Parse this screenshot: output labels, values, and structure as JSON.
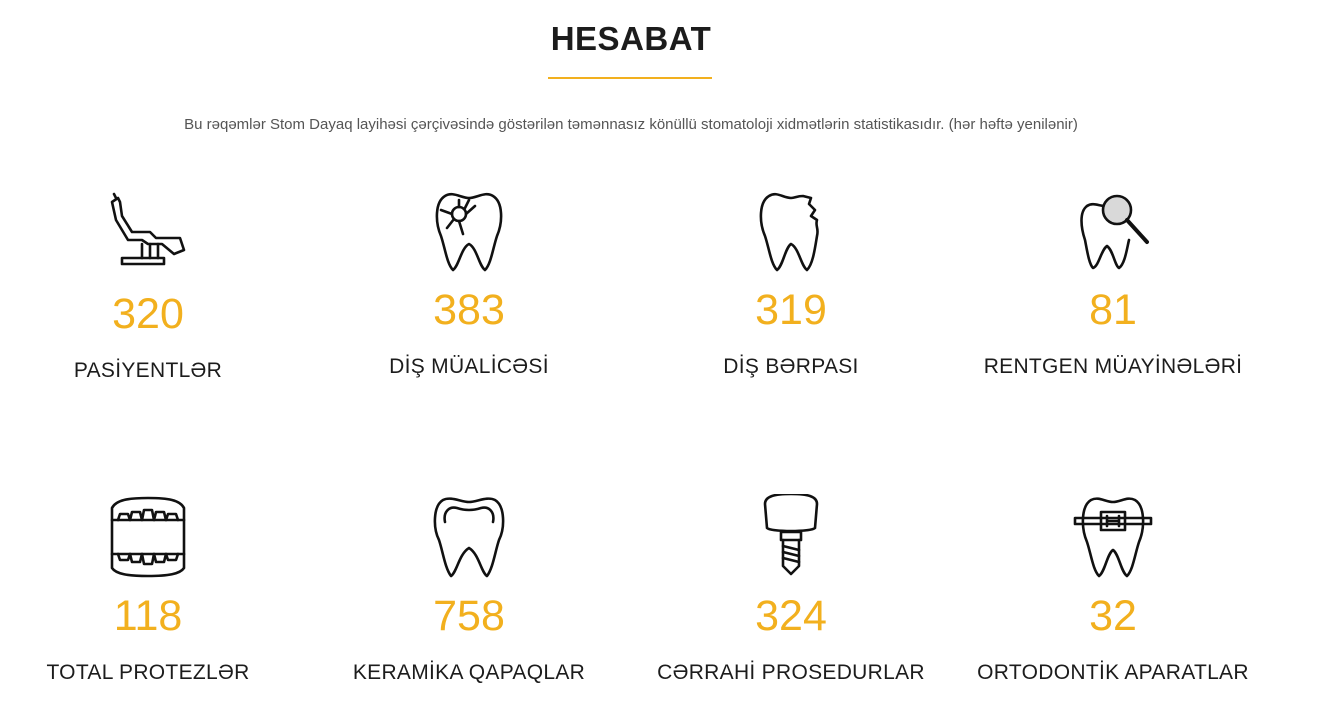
{
  "header": {
    "title": "HESABAT",
    "subtitle": "Bu rəqəmlər Stom Dayaq layihəsi çərçivəsində göstərilən təmənnasız könüllü stomatoloji xidmətlərin statistikasıdır. (hər həftə yenilənir)",
    "accent_color": "#f2b01e"
  },
  "stats": [
    {
      "icon": "dental-chair-icon",
      "value": "320",
      "label": "PASİYENTLƏR"
    },
    {
      "icon": "tooth-caries-icon",
      "value": "383",
      "label": "DİŞ MÜALİCƏSİ"
    },
    {
      "icon": "broken-tooth-icon",
      "value": "319",
      "label": "DİŞ BƏRPASI"
    },
    {
      "icon": "tooth-magnifier-icon",
      "value": "81",
      "label": "RENTGEN MÜAYİNƏLƏRİ"
    },
    {
      "icon": "dentures-icon",
      "value": "118",
      "label": "TOTAL PROTEZLƏR"
    },
    {
      "icon": "tooth-crown-icon",
      "value": "758",
      "label": "KERAMİKA QAPAQLAR"
    },
    {
      "icon": "dental-implant-icon",
      "value": "324",
      "label": "CƏRRAHİ PROSEDURLAR"
    },
    {
      "icon": "tooth-braces-icon",
      "value": "32",
      "label": "ORTODONTİK APARATLAR"
    }
  ]
}
